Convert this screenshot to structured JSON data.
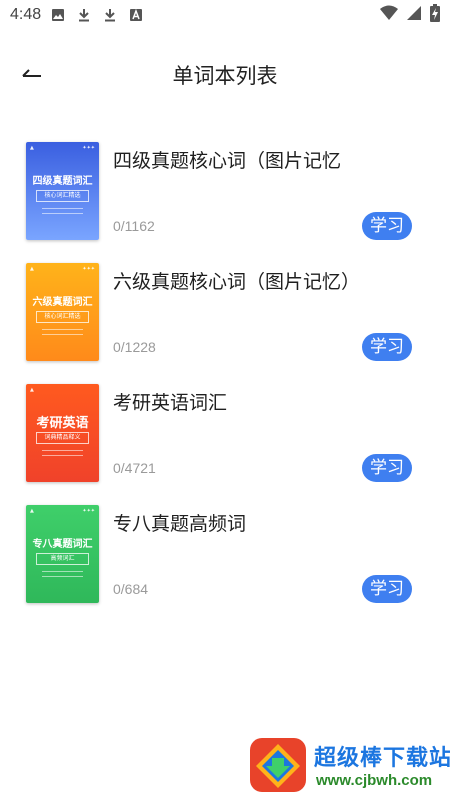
{
  "status_bar": {
    "time": "4:48",
    "left_icons": [
      "image-icon",
      "download-icon",
      "download-icon",
      "text-a-icon"
    ],
    "right_icons": [
      "wifi-icon",
      "signal-icon",
      "battery-charging-icon"
    ]
  },
  "header": {
    "back_icon": "arrow-left-icon",
    "title": "单词本列表"
  },
  "books": [
    {
      "title": "四级真题核心词（图片记忆",
      "count": "0/1162",
      "button": "学习",
      "cover": {
        "title": "四级真题词汇",
        "subtitle": "核心词汇精选",
        "color_top": "#3a5fe0",
        "color_bottom": "#7aa5ff"
      }
    },
    {
      "title": "六级真题核心词（图片记忆）",
      "count": "0/1228",
      "button": "学习",
      "cover": {
        "title": "六级真题词汇",
        "subtitle": "核心词汇精选",
        "color_top": "#ffb31a",
        "color_bottom": "#ff8a1a"
      }
    },
    {
      "title": "考研英语词汇",
      "count": "0/4721",
      "button": "学习",
      "cover": {
        "title": "考研英语",
        "subtitle": "词典精品释义",
        "color_top": "#ff5a1f",
        "color_bottom": "#f0422a"
      }
    },
    {
      "title": "专八真题高频词",
      "count": "0/684",
      "button": "学习",
      "cover": {
        "title": "专八真题词汇",
        "subtitle": "高频词汇",
        "color_top": "#3fcf6a",
        "color_bottom": "#2fb85a"
      }
    }
  ],
  "watermark": {
    "name": "超级棒下载站",
    "url": "www.cjbwh.com"
  },
  "colors": {
    "accent": "#3f7ff0",
    "count_text": "#9a9a9a"
  }
}
